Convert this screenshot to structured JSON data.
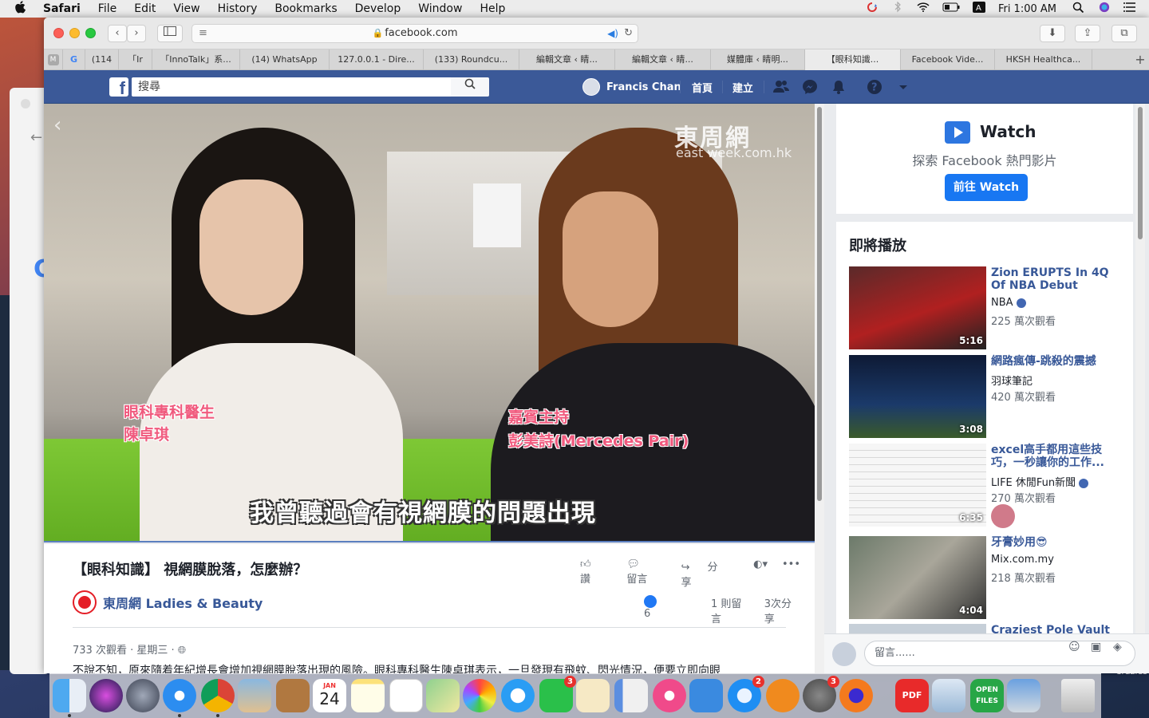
{
  "menubar": {
    "app": "Safari",
    "items": [
      "File",
      "Edit",
      "View",
      "History",
      "Bookmarks",
      "Develop",
      "Window",
      "Help"
    ],
    "clock": "Fri 1:00 AM"
  },
  "browser": {
    "url": "facebook.com",
    "tabs": [
      {
        "label": "(114"
      },
      {
        "label": "「Ir"
      },
      {
        "label": "「InnoTalk」系..."
      },
      {
        "label": "(14) WhatsApp"
      },
      {
        "label": "127.0.0.1 - Dire..."
      },
      {
        "label": "(133) Roundcu..."
      },
      {
        "label": "編輯文章 ‹ 睛..."
      },
      {
        "label": "編輯文章 ‹ 睛..."
      },
      {
        "label": "媒體庫 ‹ 睛明..."
      },
      {
        "label": "【眼科知識..."
      },
      {
        "label": "Facebook Vide..."
      },
      {
        "label": "HKSH Healthca..."
      }
    ]
  },
  "facebook": {
    "logo": "f",
    "search_placeholder": "搜尋",
    "user_name": "Francis Chan",
    "nav_home": "首頁",
    "nav_create": "建立"
  },
  "video": {
    "watermark": "東周網",
    "watermark_url": "east week.com.hk",
    "tag_left_line1": "眼科專科醫生",
    "tag_left_line2": "陳卓琪",
    "tag_right_line1": "嘉賓主持",
    "tag_right_line2": "彭美詩(Mercedes Pair)",
    "subtitle": "我曾聽過會有視網膜的問題出現"
  },
  "post": {
    "title": "【眼科知識】 視網膜脫落，怎麼辦？",
    "like_label": "讚",
    "comment_label": "留言",
    "share_label": "分享",
    "page_name": "東周網 Ladies & Beauty",
    "like_count": "6",
    "comment_count": "1 則留言",
    "share_count": "3次分享",
    "meta": "733 次觀看 · 星期三 ·",
    "body": "不說不知，原來隨着年紀增長會增加視網膜脫落出現的風險。眼科專科醫生陳卓琪表示，一旦發現有飛蚊、閃光情況，便要立即向眼"
  },
  "watch": {
    "title": "Watch",
    "desc": "探索 Facebook 熱門影片",
    "button": "前往 Watch"
  },
  "upnext": {
    "heading": "即將播放",
    "items": [
      {
        "title": "Zion ERUPTS In 4Q Of NBA Debut",
        "source": "NBA",
        "views": "225 萬次觀看",
        "duration": "5:16"
      },
      {
        "title": "網路瘋傳-跳殺的震撼",
        "source": "羽球筆記",
        "views": "420 萬次觀看",
        "duration": "3:08"
      },
      {
        "title": "excel高手都用這些技巧，一秒讓你的工作...",
        "source": "LIFE 休閒Fun新聞",
        "views": "270 萬次觀看",
        "duration": "6:35"
      },
      {
        "title": "牙膏妙用😎",
        "source": "Mix.com.my",
        "views": "218 萬次觀看",
        "duration": "4:04"
      },
      {
        "title": "Craziest Pole Vault You",
        "source": "",
        "views": "",
        "duration": ""
      }
    ]
  },
  "comment": {
    "placeholder": "留言......"
  },
  "dock": {
    "calendar_month": "JAN",
    "calendar_day": "24",
    "facetime_badge": "3",
    "appstore_badge": "2",
    "prefs_badge": "3",
    "pdf_label": "PDF",
    "openfiles_label": "OPEN FILES"
  },
  "peek": {
    "right_text": "Crazies"
  },
  "colors": {
    "facebook_blue": "#3b5998",
    "link_blue": "#385898",
    "button_blue": "#1877f2"
  }
}
